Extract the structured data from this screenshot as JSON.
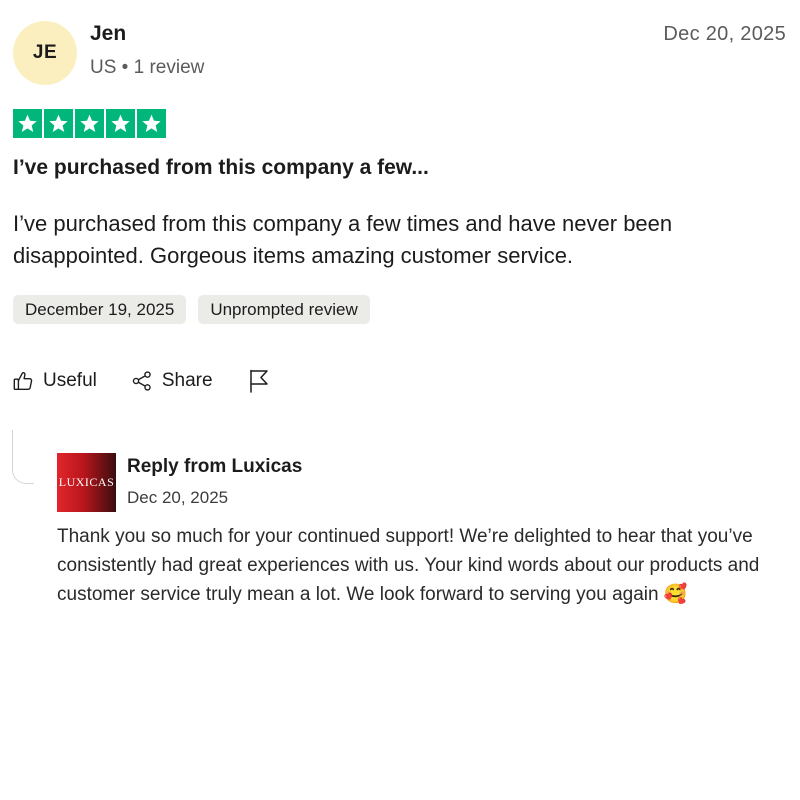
{
  "reviewer": {
    "initials": "JE",
    "name": "Jen",
    "meta": "US • 1 review"
  },
  "review": {
    "date": "Dec 20, 2025",
    "rating": 5,
    "star_color": "#00b67a",
    "title": "I’ve purchased from this company a few...",
    "body": "I’ve purchased from this company a few times and have never been disappointed. Gorgeous items amazing customer service.",
    "experience_date": "December 19, 2025",
    "label": "Unprompted review"
  },
  "actions": {
    "useful_label": "Useful",
    "share_label": "Share",
    "useful_icon": "thumbs-up-icon",
    "share_icon": "share-icon",
    "report_icon": "flag-icon"
  },
  "reply": {
    "logo_text": "LUXICAS",
    "title": "Reply from Luxicas",
    "date": "Dec 20, 2025",
    "body": "Thank you so much for your continued support! We’re delighted to hear that you’ve consistently had great experiences with us. Your kind words about our products and customer service truly mean a lot. We look forward to serving you again 🥰"
  }
}
